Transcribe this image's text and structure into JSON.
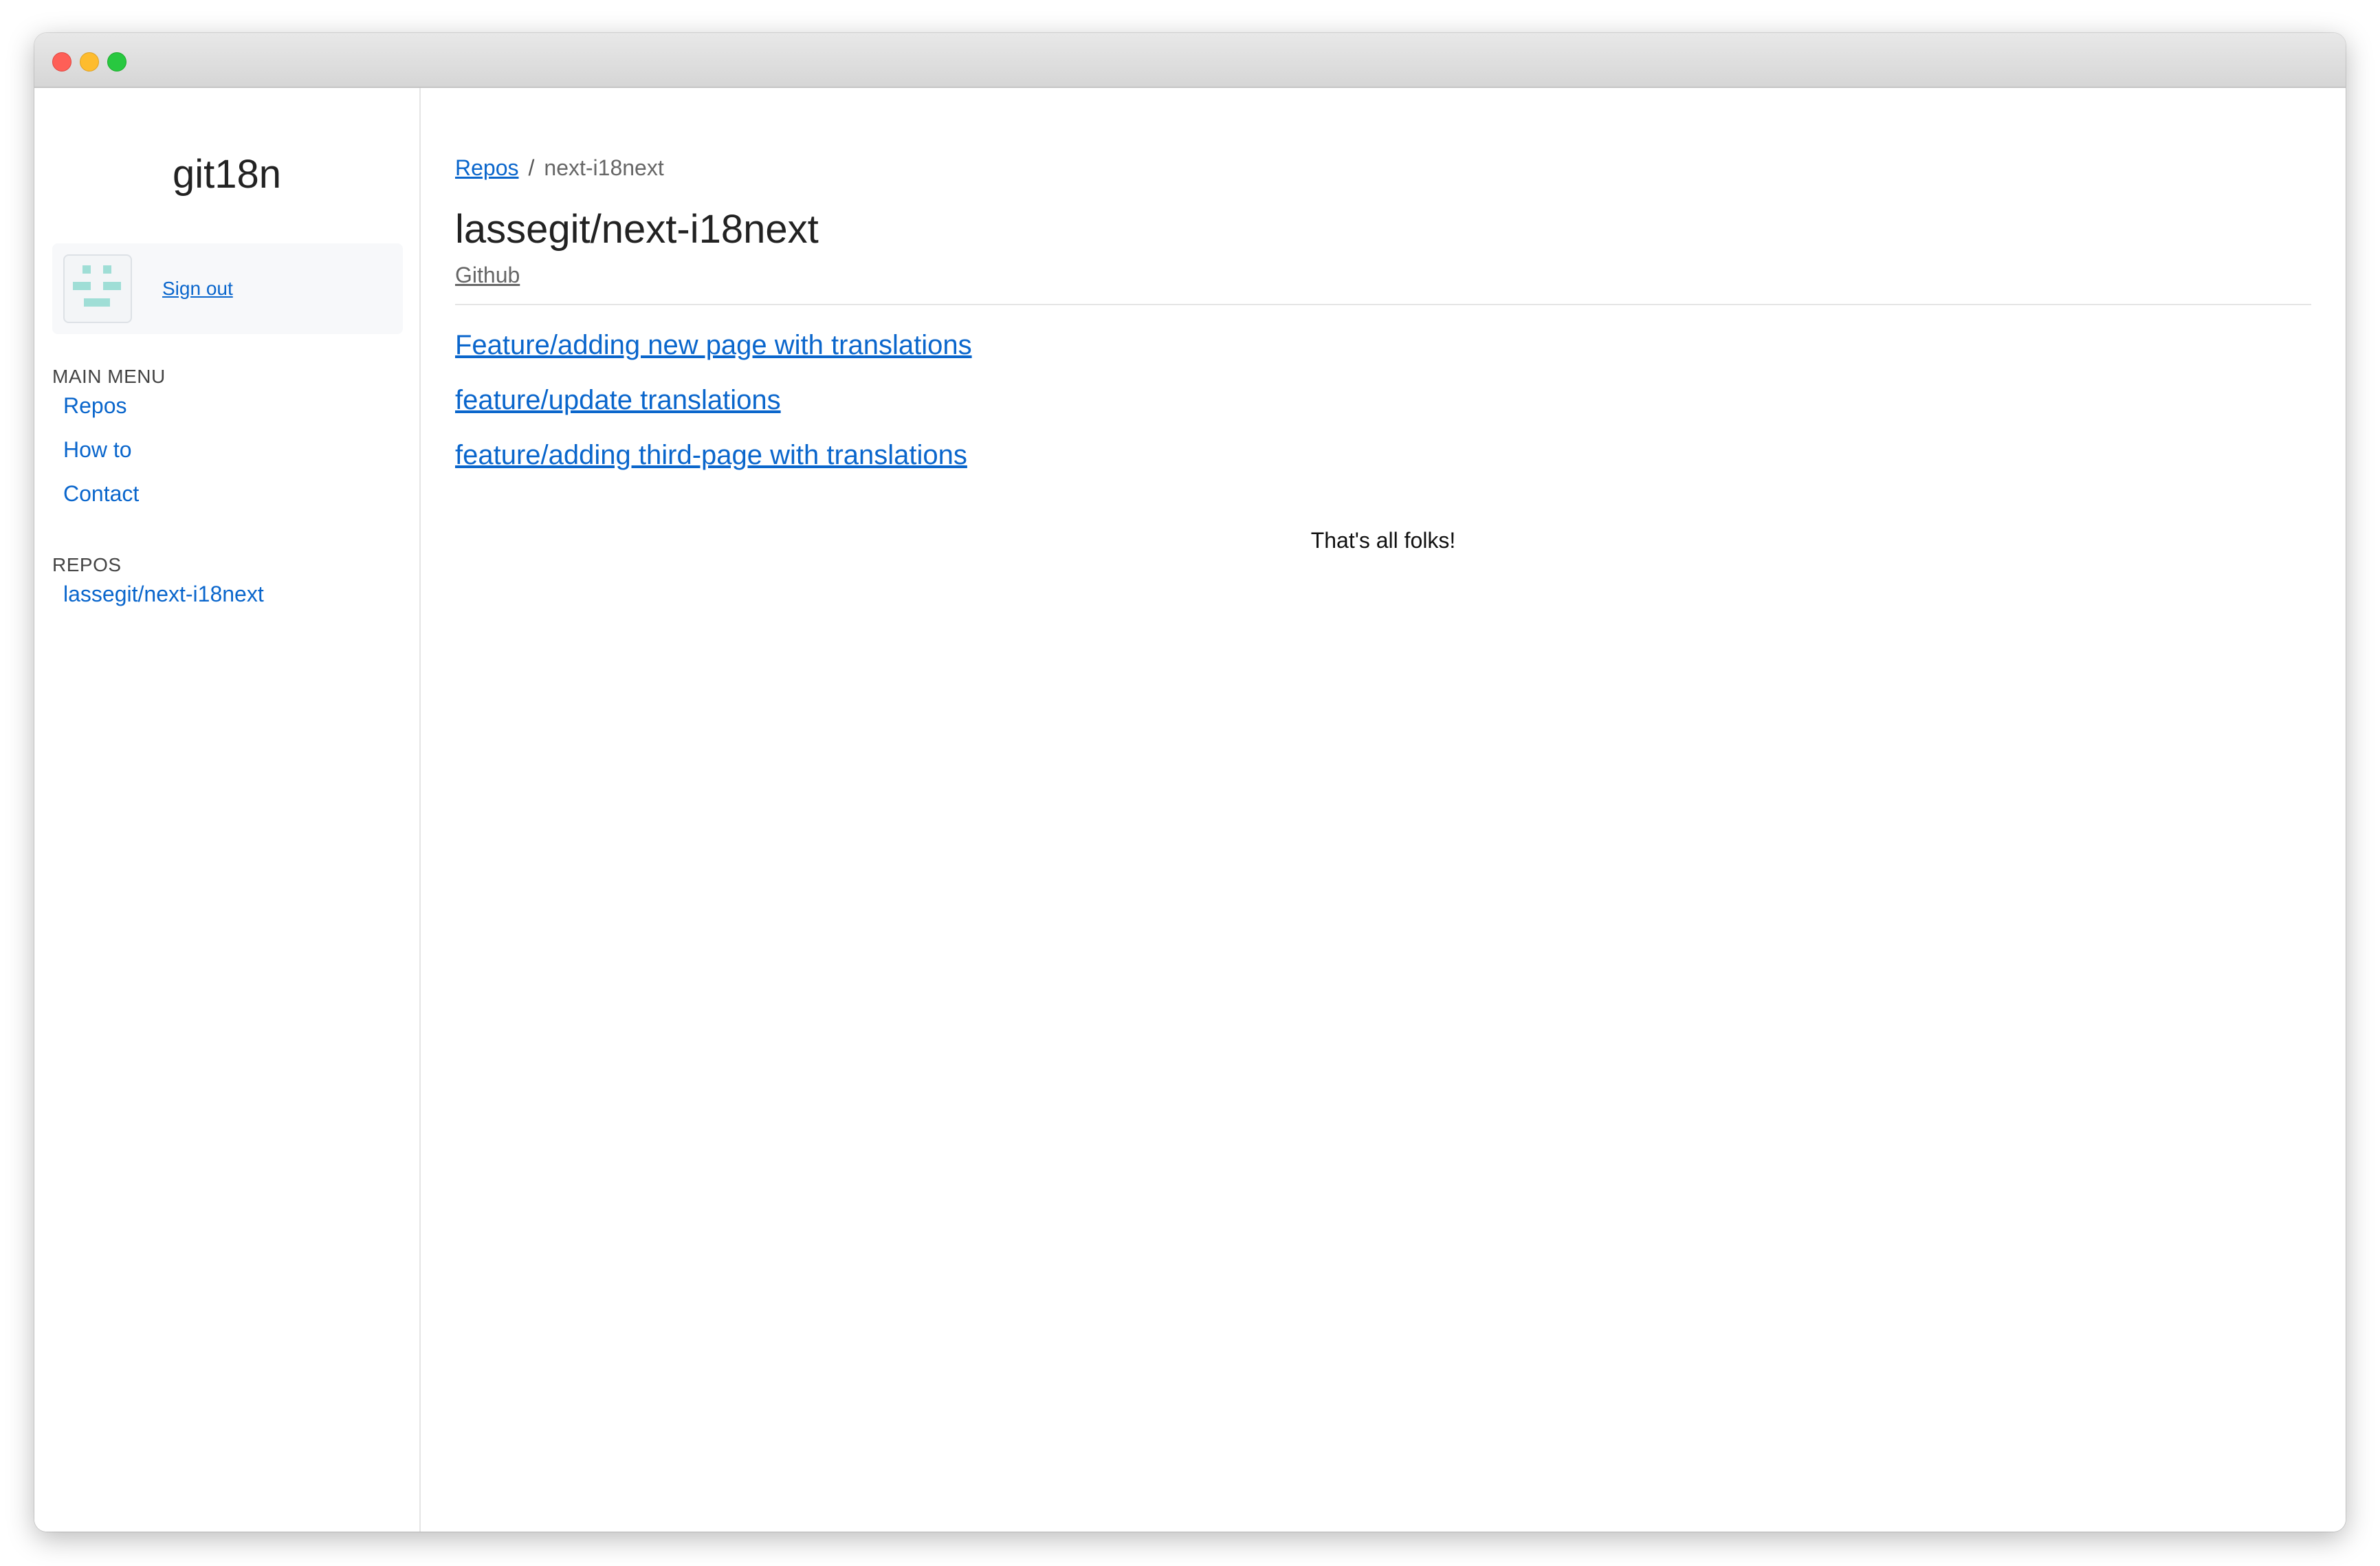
{
  "window": {
    "controls": [
      "close",
      "minimize",
      "maximize"
    ]
  },
  "sidebar": {
    "brand": "git18n",
    "user": {
      "avatar_icon": "identicon-avatar",
      "sign_out_label": "Sign out"
    },
    "main_menu": {
      "heading": "MAIN MENU",
      "items": [
        {
          "label": "Repos"
        },
        {
          "label": "How to"
        },
        {
          "label": "Contact"
        }
      ]
    },
    "repos": {
      "heading": "REPOS",
      "items": [
        {
          "label": "lassegit/next-i18next"
        }
      ]
    }
  },
  "main": {
    "breadcrumb": {
      "root_label": "Repos",
      "separator": "/",
      "current": "next-i18next"
    },
    "title": "lassegit/next-i18next",
    "github_label": "Github",
    "branches": [
      {
        "label": "Feature/adding new page with translations"
      },
      {
        "label": "feature/update translations"
      },
      {
        "label": "feature/adding third-page with translations"
      }
    ],
    "end_message": "That's all folks!"
  },
  "colors": {
    "link": "#0a66cc",
    "text": "#222222",
    "muted": "#666666",
    "avatar_accent": "#9fded6"
  }
}
